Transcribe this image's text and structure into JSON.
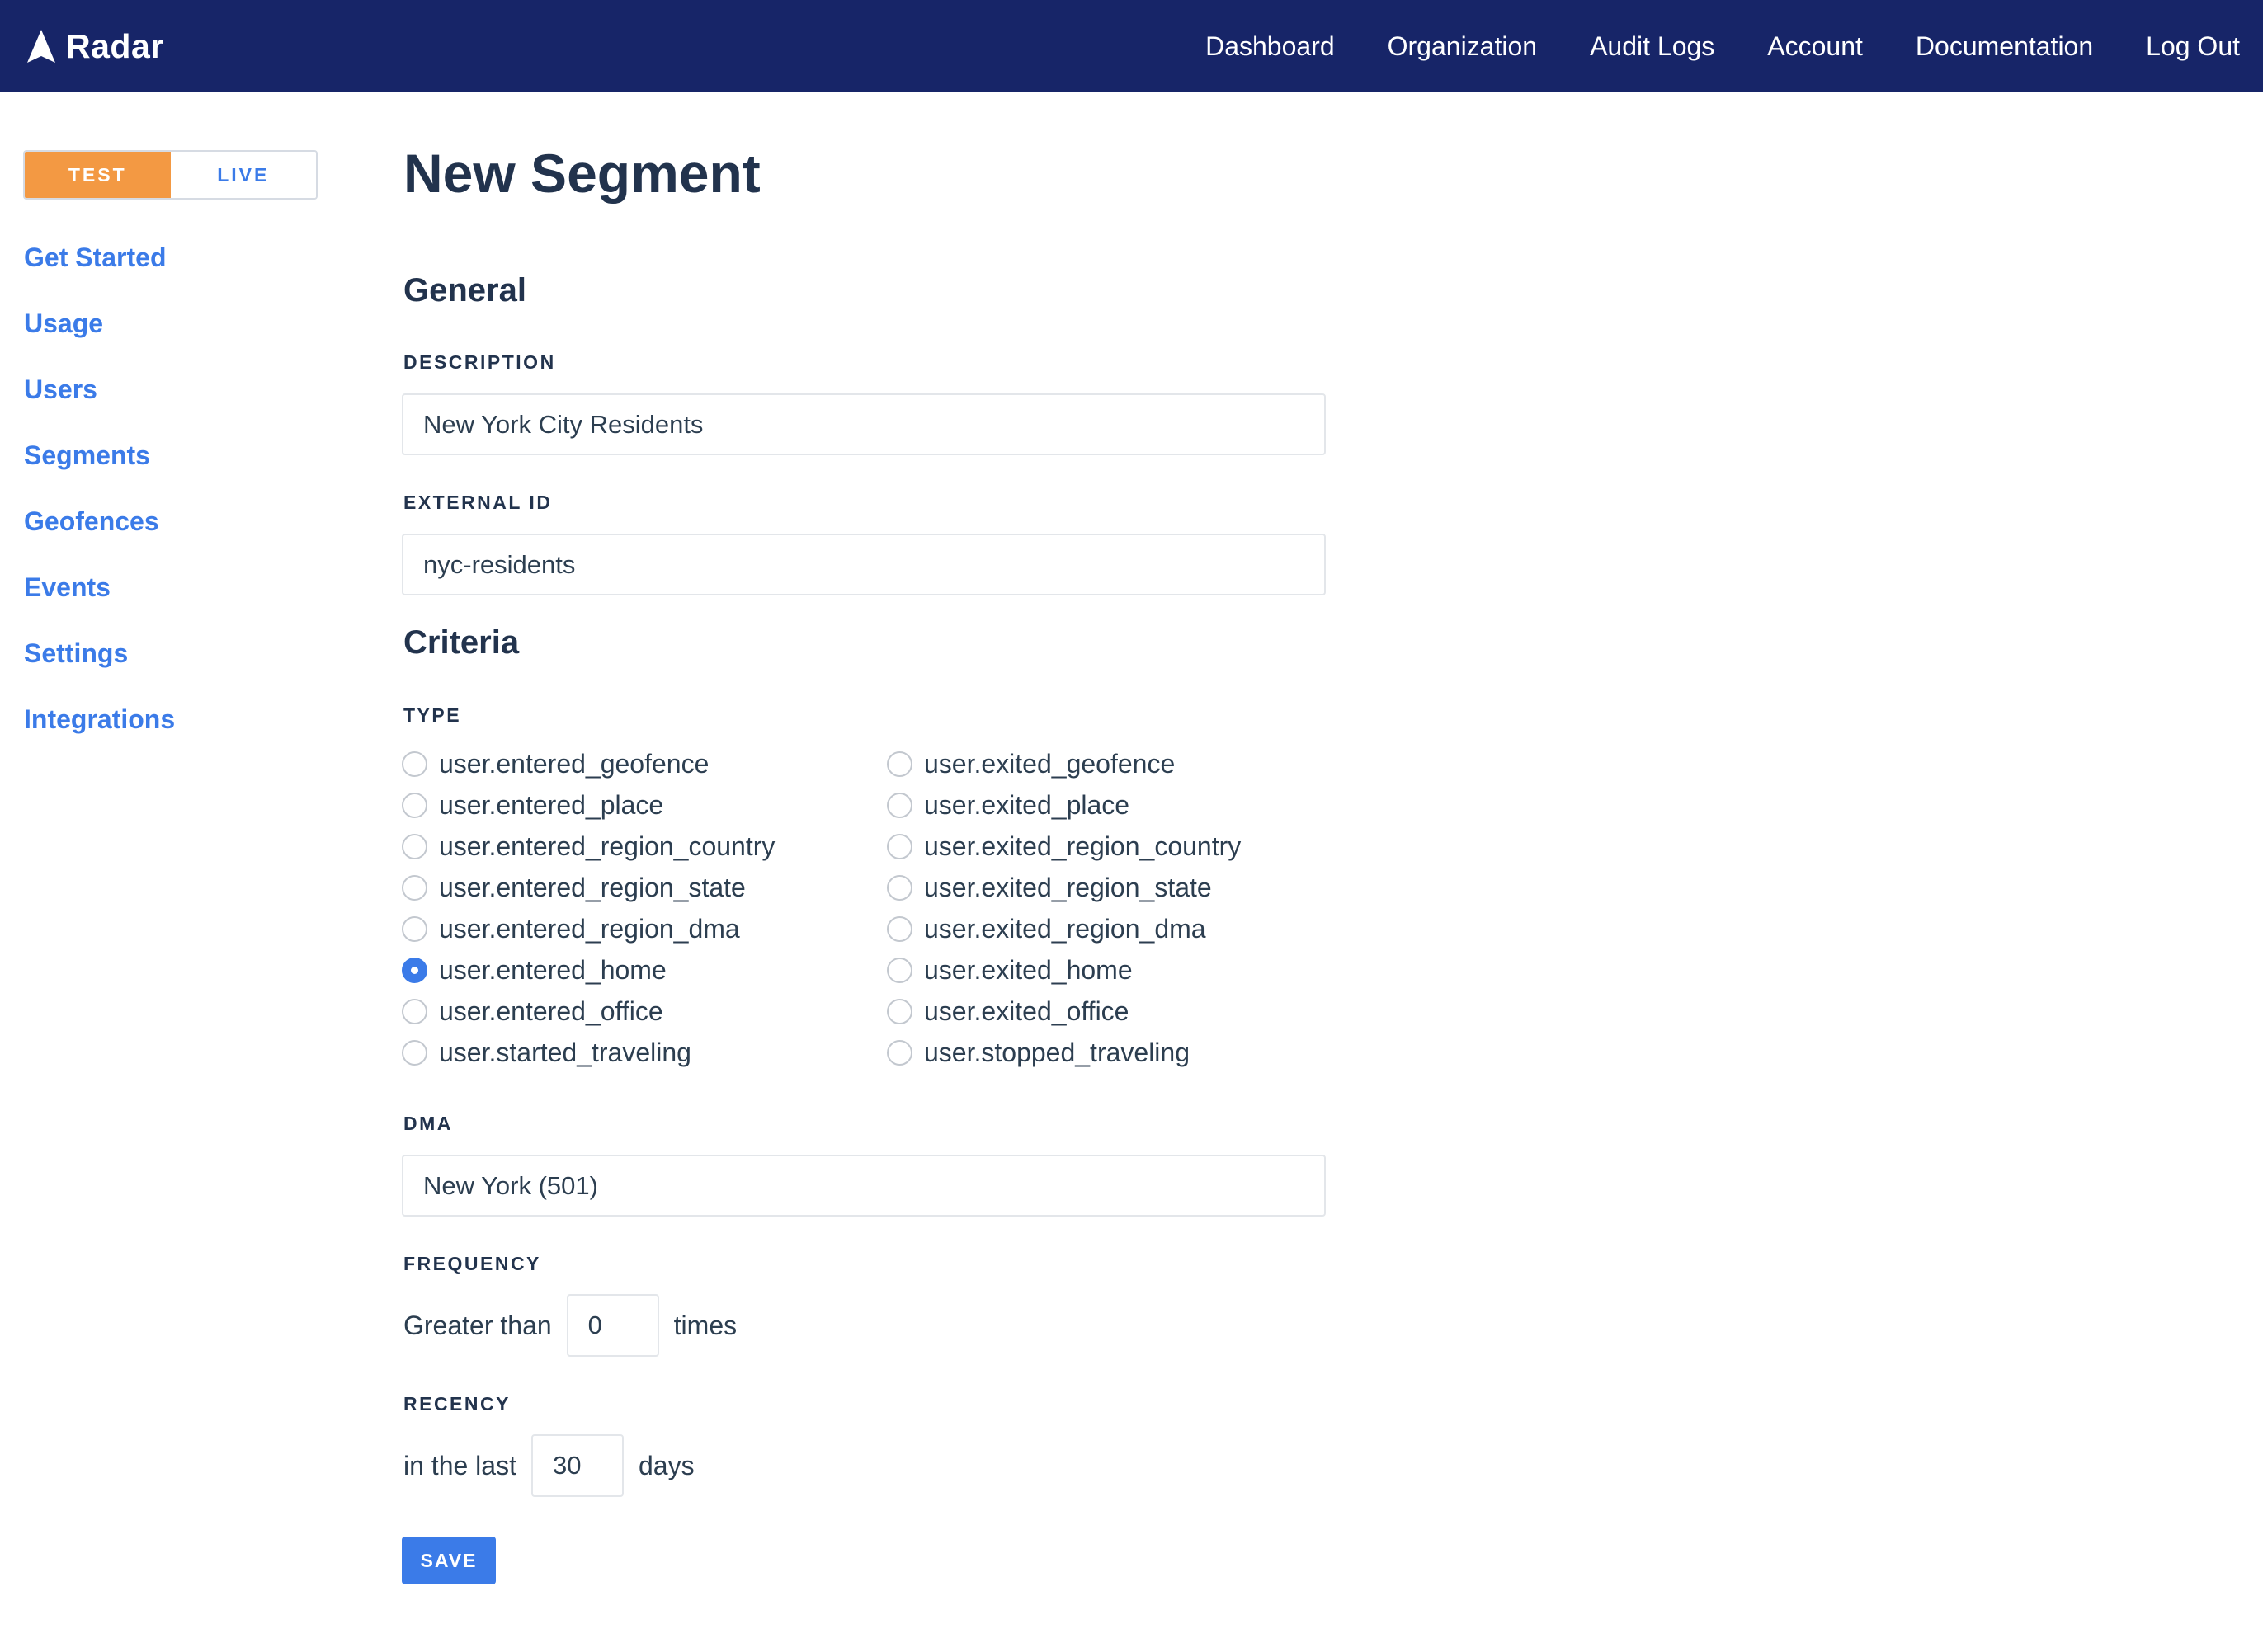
{
  "brand": {
    "name": "Radar"
  },
  "nav": {
    "items": [
      "Dashboard",
      "Organization",
      "Audit Logs",
      "Account",
      "Documentation",
      "Log Out"
    ]
  },
  "env": {
    "test": "TEST",
    "live": "LIVE",
    "selected": "TEST"
  },
  "sidebar": {
    "items": [
      "Get Started",
      "Usage",
      "Users",
      "Segments",
      "Geofences",
      "Events",
      "Settings",
      "Integrations"
    ]
  },
  "page": {
    "title": "New Segment"
  },
  "general": {
    "title": "General",
    "description_label": "DESCRIPTION",
    "description_value": "New York City Residents",
    "external_id_label": "EXTERNAL ID",
    "external_id_value": "nyc-residents"
  },
  "criteria": {
    "title": "Criteria",
    "type_label": "TYPE",
    "types_left": [
      "user.entered_geofence",
      "user.entered_place",
      "user.entered_region_country",
      "user.entered_region_state",
      "user.entered_region_dma",
      "user.entered_home",
      "user.entered_office",
      "user.started_traveling"
    ],
    "types_right": [
      "user.exited_geofence",
      "user.exited_place",
      "user.exited_region_country",
      "user.exited_region_state",
      "user.exited_region_dma",
      "user.exited_home",
      "user.exited_office",
      "user.stopped_traveling"
    ],
    "selected_type": "user.entered_home",
    "dma_label": "DMA",
    "dma_value": "New York (501)",
    "frequency_label": "FREQUENCY",
    "frequency_prefix": "Greater than",
    "frequency_value": "0",
    "frequency_suffix": "times",
    "recency_label": "RECENCY",
    "recency_prefix": "in the last",
    "recency_value": "30",
    "recency_suffix": "days"
  },
  "actions": {
    "save": "SAVE"
  },
  "colors": {
    "nav_bg": "#172568",
    "accent": "#3b7be8",
    "test_orange": "#f39943",
    "heading": "#22334d"
  }
}
